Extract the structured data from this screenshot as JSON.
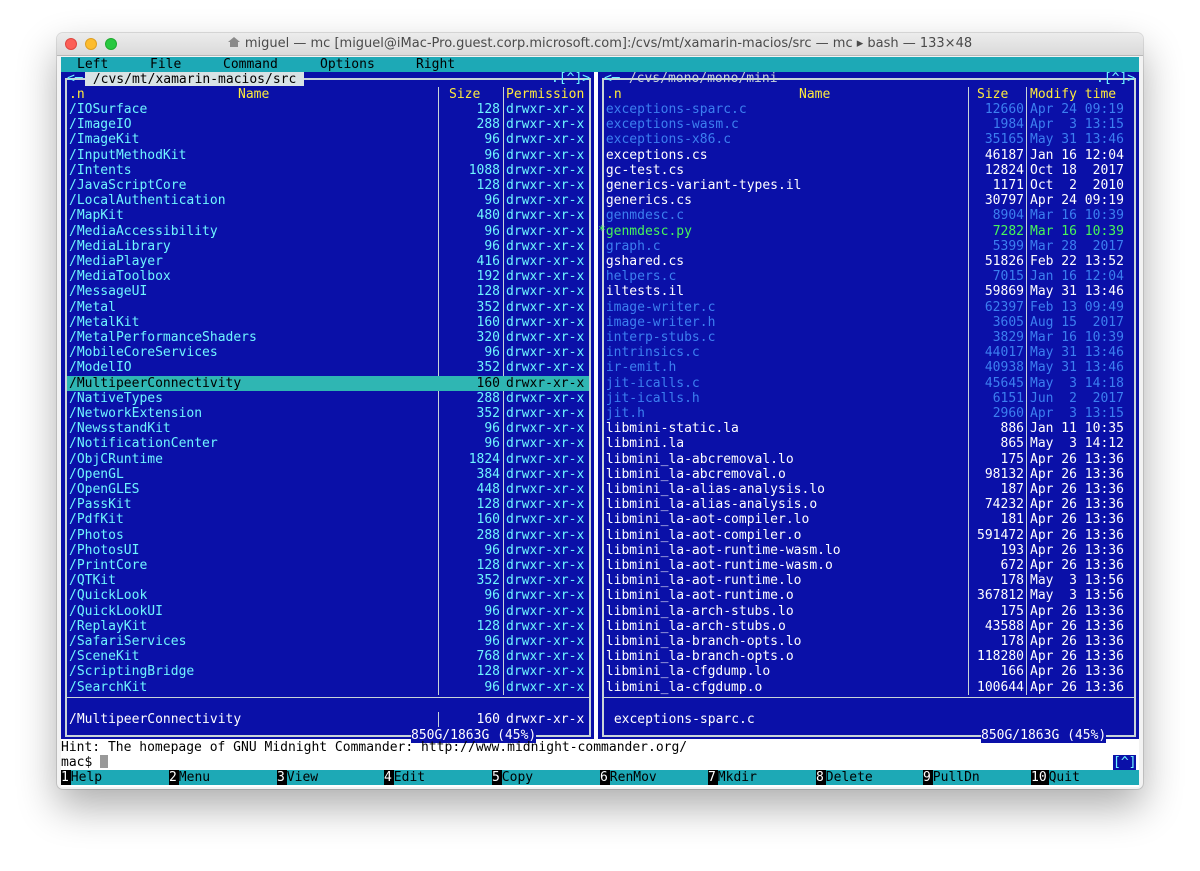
{
  "window": {
    "title": "miguel — mc [miguel@iMac-Pro.guest.corp.microsoft.com]:/cvs/mt/xamarin-macios/src — mc ▸ bash — 133×48"
  },
  "menu": [
    "Left",
    "File",
    "Command",
    "Options",
    "Right"
  ],
  "left_panel": {
    "path": " /cvs/mt/xamarin-macios/src ",
    "arrows": "<─",
    "corner": ".[^]>",
    "headers": [
      ".n",
      "Name",
      "Size",
      "Permission"
    ],
    "rows": [
      {
        "name": "/IOSurface",
        "size": "128",
        "perm": "drwxr-xr-x"
      },
      {
        "name": "/ImageIO",
        "size": "288",
        "perm": "drwxr-xr-x"
      },
      {
        "name": "/ImageKit",
        "size": "96",
        "perm": "drwxr-xr-x"
      },
      {
        "name": "/InputMethodKit",
        "size": "96",
        "perm": "drwxr-xr-x"
      },
      {
        "name": "/Intents",
        "size": "1088",
        "perm": "drwxr-xr-x"
      },
      {
        "name": "/JavaScriptCore",
        "size": "128",
        "perm": "drwxr-xr-x"
      },
      {
        "name": "/LocalAuthentication",
        "size": "96",
        "perm": "drwxr-xr-x"
      },
      {
        "name": "/MapKit",
        "size": "480",
        "perm": "drwxr-xr-x"
      },
      {
        "name": "/MediaAccessibility",
        "size": "96",
        "perm": "drwxr-xr-x"
      },
      {
        "name": "/MediaLibrary",
        "size": "96",
        "perm": "drwxr-xr-x"
      },
      {
        "name": "/MediaPlayer",
        "size": "416",
        "perm": "drwxr-xr-x"
      },
      {
        "name": "/MediaToolbox",
        "size": "192",
        "perm": "drwxr-xr-x"
      },
      {
        "name": "/MessageUI",
        "size": "128",
        "perm": "drwxr-xr-x"
      },
      {
        "name": "/Metal",
        "size": "352",
        "perm": "drwxr-xr-x"
      },
      {
        "name": "/MetalKit",
        "size": "160",
        "perm": "drwxr-xr-x"
      },
      {
        "name": "/MetalPerformanceShaders",
        "size": "320",
        "perm": "drwxr-xr-x"
      },
      {
        "name": "/MobileCoreServices",
        "size": "96",
        "perm": "drwxr-xr-x"
      },
      {
        "name": "/ModelIO",
        "size": "352",
        "perm": "drwxr-xr-x"
      },
      {
        "name": "/MultipeerConnectivity",
        "size": "160",
        "perm": "drwxr-xr-x",
        "selected": true
      },
      {
        "name": "/NativeTypes",
        "size": "288",
        "perm": "drwxr-xr-x"
      },
      {
        "name": "/NetworkExtension",
        "size": "352",
        "perm": "drwxr-xr-x"
      },
      {
        "name": "/NewsstandKit",
        "size": "96",
        "perm": "drwxr-xr-x"
      },
      {
        "name": "/NotificationCenter",
        "size": "96",
        "perm": "drwxr-xr-x"
      },
      {
        "name": "/ObjCRuntime",
        "size": "1824",
        "perm": "drwxr-xr-x"
      },
      {
        "name": "/OpenGL",
        "size": "384",
        "perm": "drwxr-xr-x"
      },
      {
        "name": "/OpenGLES",
        "size": "448",
        "perm": "drwxr-xr-x"
      },
      {
        "name": "/PassKit",
        "size": "128",
        "perm": "drwxr-xr-x"
      },
      {
        "name": "/PdfKit",
        "size": "160",
        "perm": "drwxr-xr-x"
      },
      {
        "name": "/Photos",
        "size": "288",
        "perm": "drwxr-xr-x"
      },
      {
        "name": "/PhotosUI",
        "size": "96",
        "perm": "drwxr-xr-x"
      },
      {
        "name": "/PrintCore",
        "size": "128",
        "perm": "drwxr-xr-x"
      },
      {
        "name": "/QTKit",
        "size": "352",
        "perm": "drwxr-xr-x"
      },
      {
        "name": "/QuickLook",
        "size": "96",
        "perm": "drwxr-xr-x"
      },
      {
        "name": "/QuickLookUI",
        "size": "96",
        "perm": "drwxr-xr-x"
      },
      {
        "name": "/ReplayKit",
        "size": "128",
        "perm": "drwxr-xr-x"
      },
      {
        "name": "/SafariServices",
        "size": "96",
        "perm": "drwxr-xr-x"
      },
      {
        "name": "/SceneKit",
        "size": "768",
        "perm": "drwxr-xr-x"
      },
      {
        "name": "/ScriptingBridge",
        "size": "128",
        "perm": "drwxr-xr-x"
      },
      {
        "name": "/SearchKit",
        "size": "96",
        "perm": "drwxr-xr-x"
      }
    ],
    "status_name": "/MultipeerConnectivity",
    "status_size": "160",
    "status_perm": "drwxr-xr-x",
    "disk": "850G/1863G (45%)"
  },
  "right_panel": {
    "path": " /cvs/mono/mono/mini ",
    "arrows": "<─",
    "corner": ".[^]>",
    "headers": [
      ".n",
      "Name",
      "Size",
      "Modify time"
    ],
    "rows": [
      {
        "name": " exceptions-sparc.c",
        "size": "12660",
        "time": "Apr 24 09:19",
        "style": "dim"
      },
      {
        "name": " exceptions-wasm.c",
        "size": "1984",
        "time": "Apr  3 13:15",
        "style": "dim"
      },
      {
        "name": " exceptions-x86.c",
        "size": "35165",
        "time": "May 31 13:46",
        "style": "dim"
      },
      {
        "name": " exceptions.cs",
        "size": "46187",
        "time": "Jan 16 12:04",
        "style": "white"
      },
      {
        "name": " gc-test.cs",
        "size": "12824",
        "time": "Oct 18  2017",
        "style": "white"
      },
      {
        "name": " generics-variant-types.il",
        "size": "1171",
        "time": "Oct  2  2010",
        "style": "white"
      },
      {
        "name": " generics.cs",
        "size": "30797",
        "time": "Apr 24 09:19",
        "style": "white"
      },
      {
        "name": " genmdesc.c",
        "size": "8904",
        "time": "Mar 16 10:39",
        "style": "dim"
      },
      {
        "name": "*genmdesc.py",
        "size": "7282",
        "time": "Mar 16 10:39",
        "style": "green"
      },
      {
        "name": " graph.c",
        "size": "5399",
        "time": "Mar 28  2017",
        "style": "dim"
      },
      {
        "name": " gshared.cs",
        "size": "51826",
        "time": "Feb 22 13:52",
        "style": "white"
      },
      {
        "name": " helpers.c",
        "size": "7015",
        "time": "Jan 16 12:04",
        "style": "dim"
      },
      {
        "name": " iltests.il",
        "size": "59869",
        "time": "May 31 13:46",
        "style": "white"
      },
      {
        "name": " image-writer.c",
        "size": "62397",
        "time": "Feb 13 09:49",
        "style": "dim"
      },
      {
        "name": " image-writer.h",
        "size": "3605",
        "time": "Aug 15  2017",
        "style": "dim"
      },
      {
        "name": " interp-stubs.c",
        "size": "3829",
        "time": "Mar 16 10:39",
        "style": "dim"
      },
      {
        "name": " intrinsics.c",
        "size": "44017",
        "time": "May 31 13:46",
        "style": "dim"
      },
      {
        "name": " ir-emit.h",
        "size": "40938",
        "time": "May 31 13:46",
        "style": "dim"
      },
      {
        "name": " jit-icalls.c",
        "size": "45645",
        "time": "May  3 14:18",
        "style": "dim"
      },
      {
        "name": " jit-icalls.h",
        "size": "6151",
        "time": "Jun  2  2017",
        "style": "dim"
      },
      {
        "name": " jit.h",
        "size": "2960",
        "time": "Apr  3 13:15",
        "style": "dim"
      },
      {
        "name": " libmini-static.la",
        "size": "886",
        "time": "Jan 11 10:35",
        "style": "white"
      },
      {
        "name": " libmini.la",
        "size": "865",
        "time": "May  3 14:12",
        "style": "white"
      },
      {
        "name": " libmini_la-abcremoval.lo",
        "size": "175",
        "time": "Apr 26 13:36",
        "style": "white"
      },
      {
        "name": " libmini_la-abcremoval.o",
        "size": "98132",
        "time": "Apr 26 13:36",
        "style": "white"
      },
      {
        "name": " libmini_la-alias-analysis.lo",
        "size": "187",
        "time": "Apr 26 13:36",
        "style": "white"
      },
      {
        "name": " libmini_la-alias-analysis.o",
        "size": "74232",
        "time": "Apr 26 13:36",
        "style": "white"
      },
      {
        "name": " libmini_la-aot-compiler.lo",
        "size": "181",
        "time": "Apr 26 13:36",
        "style": "white"
      },
      {
        "name": " libmini_la-aot-compiler.o",
        "size": "591472",
        "time": "Apr 26 13:36",
        "style": "white"
      },
      {
        "name": " libmini_la-aot-runtime-wasm.lo",
        "size": "193",
        "time": "Apr 26 13:36",
        "style": "white"
      },
      {
        "name": " libmini_la-aot-runtime-wasm.o",
        "size": "672",
        "time": "Apr 26 13:36",
        "style": "white"
      },
      {
        "name": " libmini_la-aot-runtime.lo",
        "size": "178",
        "time": "May  3 13:56",
        "style": "white"
      },
      {
        "name": " libmini_la-aot-runtime.o",
        "size": "367812",
        "time": "May  3 13:56",
        "style": "white"
      },
      {
        "name": " libmini_la-arch-stubs.lo",
        "size": "175",
        "time": "Apr 26 13:36",
        "style": "white"
      },
      {
        "name": " libmini_la-arch-stubs.o",
        "size": "43588",
        "time": "Apr 26 13:36",
        "style": "white"
      },
      {
        "name": " libmini_la-branch-opts.lo",
        "size": "178",
        "time": "Apr 26 13:36",
        "style": "white"
      },
      {
        "name": " libmini_la-branch-opts.o",
        "size": "118280",
        "time": "Apr 26 13:36",
        "style": "white"
      },
      {
        "name": " libmini_la-cfgdump.lo",
        "size": "166",
        "time": "Apr 26 13:36",
        "style": "white"
      },
      {
        "name": " libmini_la-cfgdump.o",
        "size": "100644",
        "time": "Apr 26 13:36",
        "style": "white"
      }
    ],
    "status_name": " exceptions-sparc.c",
    "disk": "850G/1863G (45%)"
  },
  "hint": "Hint: The homepage of GNU Midnight Commander: http://www.midnight-commander.org/",
  "prompt": "mac$ ",
  "prompt_tag": "[^]",
  "function_keys": [
    {
      "num": "1",
      "label": "Help"
    },
    {
      "num": "2",
      "label": "Menu"
    },
    {
      "num": "3",
      "label": "View"
    },
    {
      "num": "4",
      "label": "Edit"
    },
    {
      "num": "5",
      "label": "Copy"
    },
    {
      "num": "6",
      "label": "RenMov"
    },
    {
      "num": "7",
      "label": "Mkdir"
    },
    {
      "num": "8",
      "label": "Delete"
    },
    {
      "num": "9",
      "label": "PullDn"
    },
    {
      "num": "10",
      "label": "Quit"
    }
  ]
}
